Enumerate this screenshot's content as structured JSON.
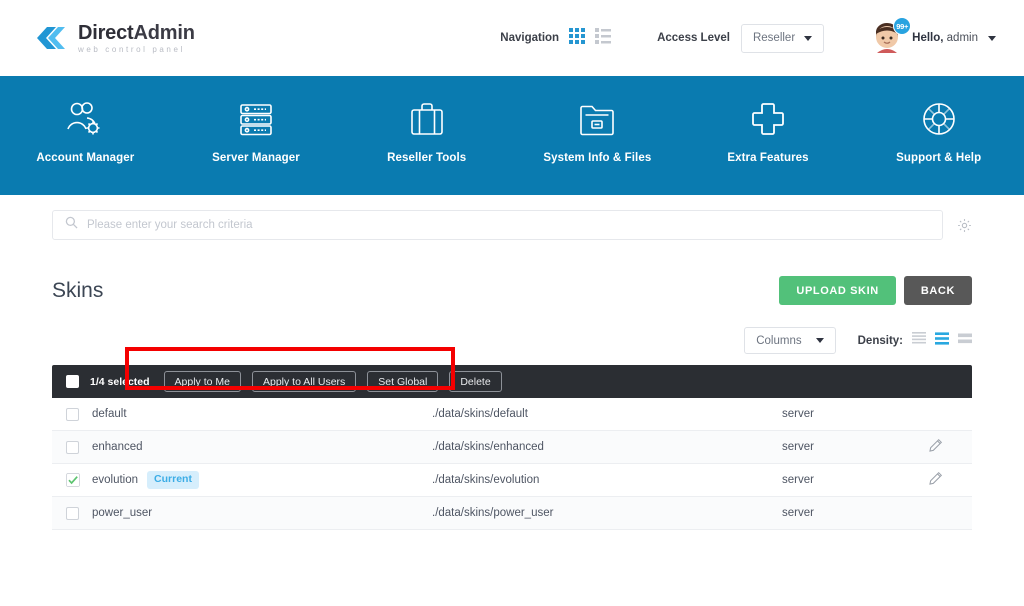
{
  "header": {
    "logo": {
      "title_bold": "Direct",
      "title_rest": "Admin",
      "subtitle": "web control panel",
      "icon": "directadmin-logo-icon"
    },
    "navigation_label": "Navigation",
    "grid_view_icon": "grid-view-icon",
    "list_view_icon": "list-view-icon",
    "access_level_label": "Access Level",
    "access_level_value": "Reseller",
    "notification_count": "99+",
    "greeting_bold": "Hello,",
    "greeting_user": " admin",
    "avatar_icon": "user-avatar-icon"
  },
  "nav": {
    "items": [
      {
        "label": "Account Manager",
        "icon": "users-gear-icon"
      },
      {
        "label": "Server Manager",
        "icon": "server-rack-icon"
      },
      {
        "label": "Reseller Tools",
        "icon": "briefcase-icon"
      },
      {
        "label": "System Info & Files",
        "icon": "folder-icon"
      },
      {
        "label": "Extra Features",
        "icon": "plus-icon"
      },
      {
        "label": "Support & Help",
        "icon": "lifebuoy-icon"
      }
    ]
  },
  "search": {
    "placeholder": "Please enter your search criteria",
    "value": "",
    "search_icon": "search-icon",
    "settings_icon": "gear-icon"
  },
  "page": {
    "title": "Skins",
    "upload_label": "UPLOAD SKIN",
    "back_label": "BACK"
  },
  "options": {
    "columns_label": "Columns",
    "density_label": "Density:",
    "density_icons": [
      "density-compact-icon",
      "density-standard-icon",
      "density-comfortable-icon"
    ],
    "density_selected_index": 1
  },
  "bulkbar": {
    "selected_text": "1/4 selected",
    "buttons": [
      {
        "label": "Apply to Me"
      },
      {
        "label": "Apply to All Users"
      },
      {
        "label": "Set Global"
      },
      {
        "label": "Delete"
      }
    ]
  },
  "table": {
    "rows": [
      {
        "name": "default",
        "path": "./data/skins/default",
        "owner": "server",
        "checked": false,
        "badge": "",
        "editable": false
      },
      {
        "name": "enhanced",
        "path": "./data/skins/enhanced",
        "owner": "server",
        "checked": false,
        "badge": "",
        "editable": true
      },
      {
        "name": "evolution",
        "path": "./data/skins/evolution",
        "owner": "server",
        "checked": true,
        "badge": "Current",
        "editable": true
      },
      {
        "name": "power_user",
        "path": "./data/skins/power_user",
        "owner": "server",
        "checked": false,
        "badge": "",
        "editable": false
      }
    ]
  },
  "annotation": {
    "color": "#f40000",
    "shape": "rectangle-highlight"
  },
  "colors": {
    "brand_blue": "#0a7bb0",
    "accent_blue": "#28a3e0",
    "green": "#52c17a",
    "gray_button": "#585858",
    "bulkbar_dark": "#2b2e33",
    "badge_bg": "#d6eefc",
    "badge_text": "#3cade6"
  }
}
